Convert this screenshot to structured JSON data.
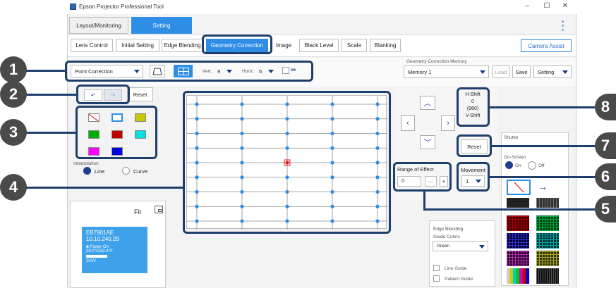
{
  "window": {
    "title": "Epson Projector Professional Tool",
    "controls": [
      "–",
      "☐",
      "✕"
    ]
  },
  "top_tabs": [
    {
      "label": "Layout/Monitoring"
    },
    {
      "label": "Setting"
    }
  ],
  "sub_tabs": [
    {
      "label": "Lens Control"
    },
    {
      "label": "Initial Setting"
    },
    {
      "label": "Edge Blending"
    },
    {
      "label": "Geometry Correction"
    },
    {
      "label": "Image"
    },
    {
      "label": "Black Level"
    },
    {
      "label": "Scale"
    },
    {
      "label": "Blanking"
    }
  ],
  "camera_assist": "Camera Assist",
  "toolbar": {
    "correction_mode": "Point Correction",
    "vert_label": "Vert.",
    "vert_value": "9",
    "horiz_label": "Horiz.",
    "horiz_value": "5"
  },
  "memory": {
    "label": "Geometry Correction Memory",
    "selected": "Memory 1",
    "load": "Load",
    "save": "Save",
    "setting": "Setting"
  },
  "undo_reset": "Reset",
  "interpolation": {
    "label": "Interpolation",
    "line": "Line",
    "curve": "Curve",
    "selected": "Line"
  },
  "grid_colors": [
    "#ffffff",
    "#ffffff",
    "#c8c800",
    "#00b000",
    "#c00000",
    "#00e0e0",
    "#ff00ff",
    "#0000e0"
  ],
  "grid": {
    "rows": 9,
    "cols": 5,
    "selected_point": "center"
  },
  "shift": {
    "h_label": "H-Shift",
    "h_value": "0",
    "h_sub": "(960)",
    "v_label": "V-Shift",
    "reset": "Reset"
  },
  "range_of_effect": {
    "label": "Range of Effect",
    "value": "0",
    "minus": "—",
    "plus": "+"
  },
  "movement": {
    "label": "Movement",
    "value": "1"
  },
  "shutter": {
    "label": "Shutter",
    "onscreen_label": "On-Screen",
    "on": "On",
    "off": "Off"
  },
  "edge_blending": {
    "title": "Edge Blending",
    "guide_colors_label": "Guide Colors",
    "guide_color": "Green",
    "line_guide": "Line Guide",
    "pattern_guide": "Pattern Guide"
  },
  "preview": {
    "fit": "Fit"
  },
  "device": {
    "name": "EB7901AE",
    "ip": "10.10.240.29",
    "status": "Power On",
    "temp": "28.0°C/82.4°F",
    "volt": "101V"
  },
  "callouts": [
    "1",
    "2",
    "3",
    "4",
    "5",
    "6",
    "7",
    "8"
  ],
  "colors": {
    "accent": "#2e8ee6",
    "callout": "#1e3f6b",
    "badge": "#4a4a4a"
  }
}
